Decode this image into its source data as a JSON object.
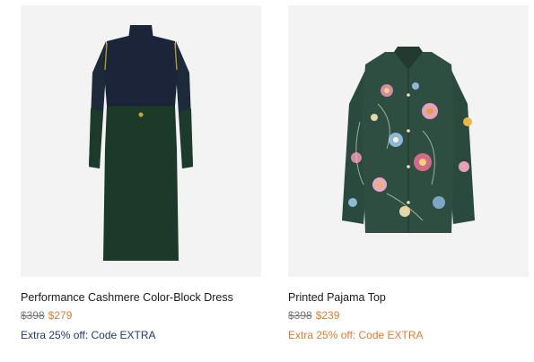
{
  "products": [
    {
      "name": "Performance Cashmere Color-Block Dress",
      "original_price": "$398",
      "sale_price": "$279",
      "promo": "Extra 25% off: Code EXTRA",
      "image": "dress-image"
    },
    {
      "name": "Printed Pajama Top",
      "original_price": "$398",
      "sale_price": "$239",
      "promo": "Extra 25% off: Code EXTRA",
      "image": "pajama-top-image"
    }
  ],
  "colors": {
    "sale_price": "#e07b2e",
    "promo_navy": "#1f3a6b",
    "promo_orange": "#e07b2e",
    "dress_top": "#1b2438",
    "dress_bottom": "#1c3a2a"
  }
}
